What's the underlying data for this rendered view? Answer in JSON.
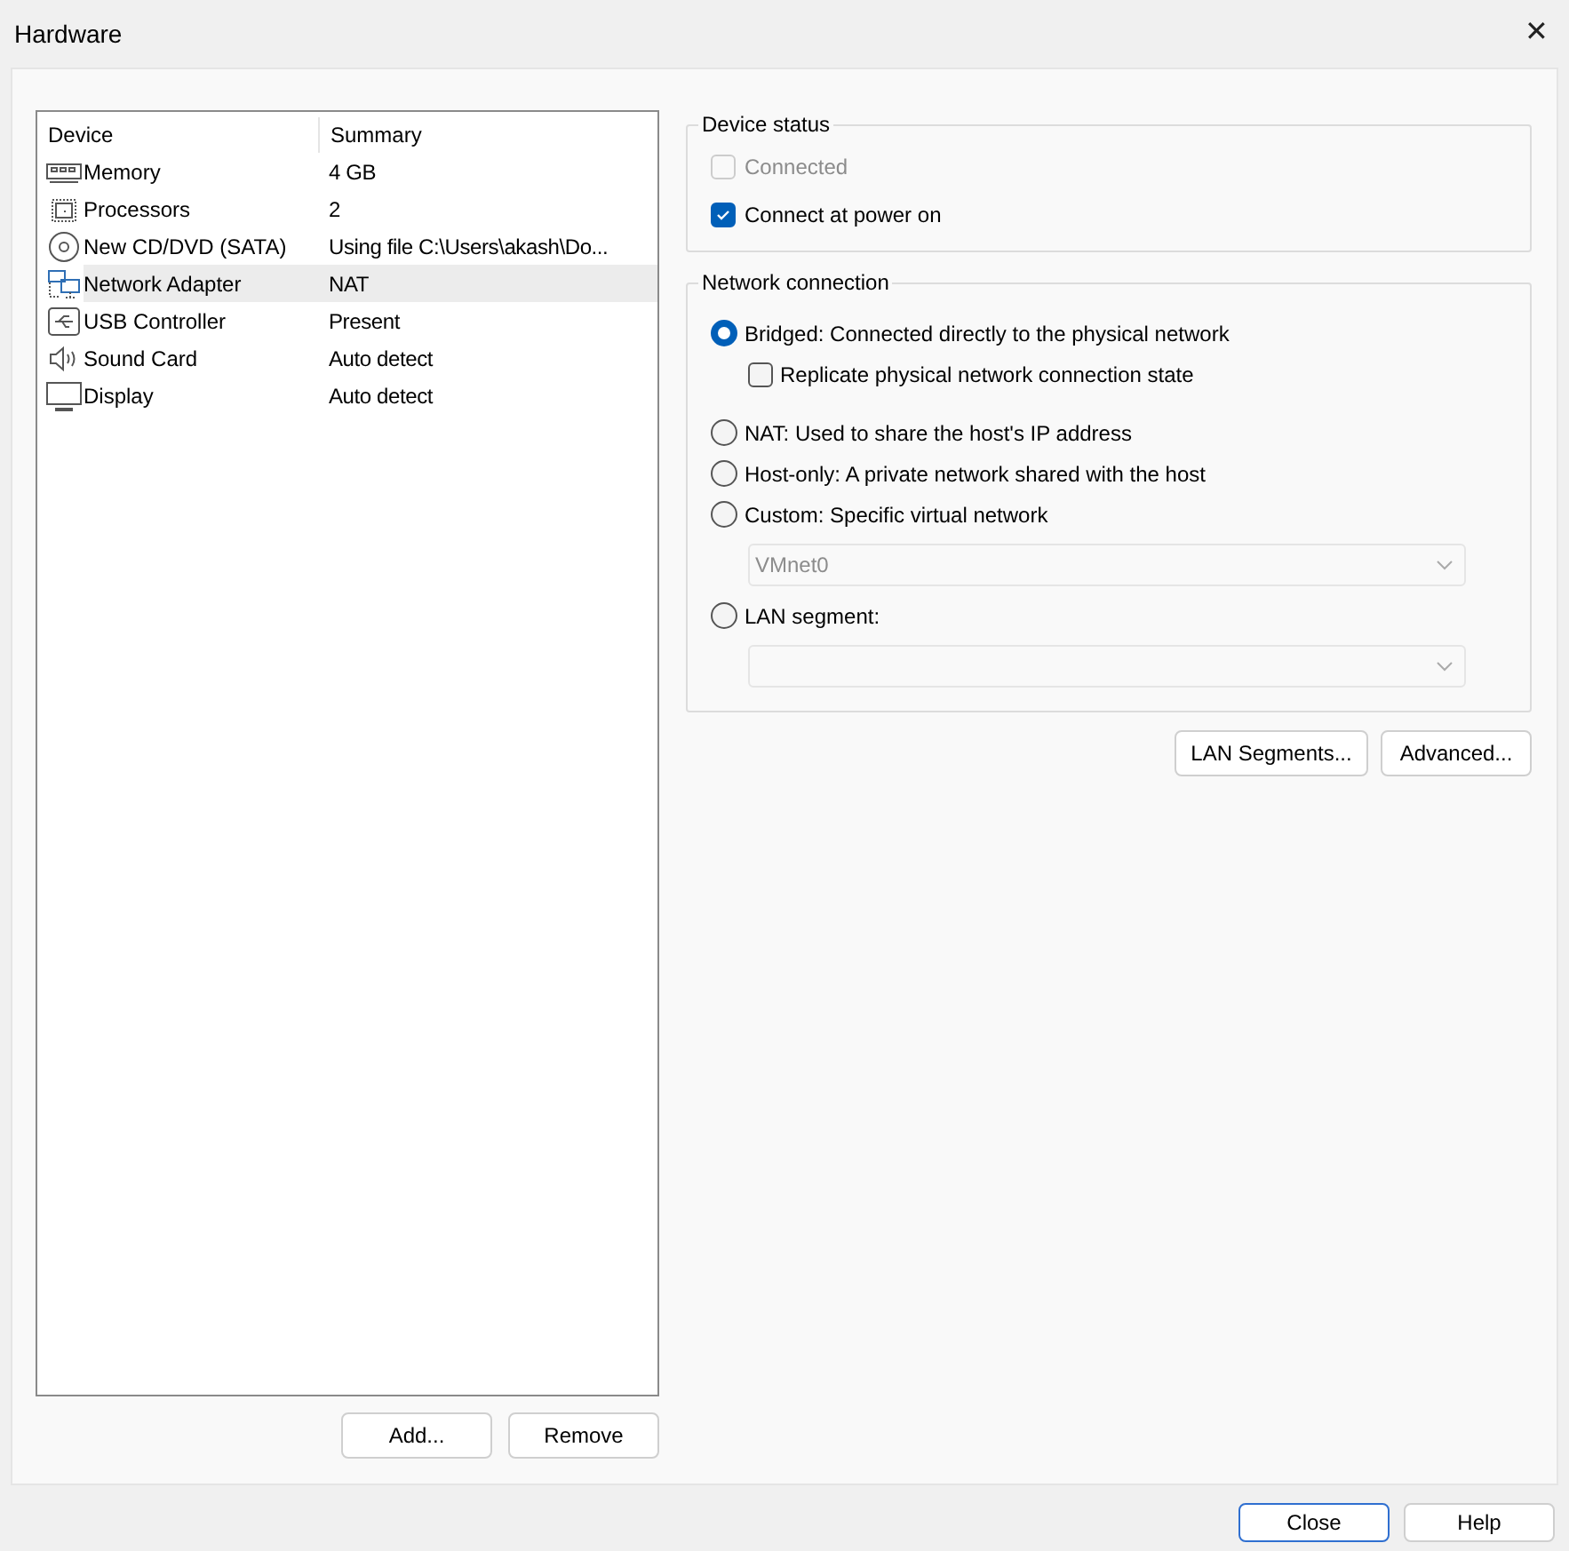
{
  "window": {
    "title": "Hardware",
    "close_glyph": "✕"
  },
  "device_table": {
    "columns": [
      "Device",
      "Summary"
    ],
    "rows": [
      {
        "kind": "memory",
        "device": "Memory",
        "summary": "4 GB",
        "selected": false
      },
      {
        "kind": "processor",
        "device": "Processors",
        "summary": "2",
        "selected": false
      },
      {
        "kind": "disc",
        "device": "New CD/DVD (SATA)",
        "summary": "Using file C:\\Users\\akash\\Do...",
        "selected": false
      },
      {
        "kind": "network",
        "device": "Network Adapter",
        "summary": "NAT",
        "selected": true
      },
      {
        "kind": "usb",
        "device": "USB Controller",
        "summary": "Present",
        "selected": false
      },
      {
        "kind": "sound",
        "device": "Sound Card",
        "summary": "Auto detect",
        "selected": false
      },
      {
        "kind": "display",
        "device": "Display",
        "summary": "Auto detect",
        "selected": false
      }
    ]
  },
  "list_buttons": [
    {
      "label": "Add...",
      "default": false
    },
    {
      "label": "Remove",
      "default": false
    }
  ],
  "device_status": {
    "title": "Device status",
    "items": [
      {
        "label": "Connected",
        "checked": false,
        "disabled": true
      },
      {
        "label": "Connect at power on",
        "checked": true,
        "disabled": false
      }
    ]
  },
  "network_connection": {
    "title": "Network connection",
    "items": [
      {
        "kind": "radio",
        "label": "Bridged: Connected directly to the physical network",
        "selected": true
      },
      {
        "kind": "checkbox",
        "label": "Replicate physical network connection state",
        "checked": false
      },
      {
        "kind": "radio",
        "label": "NAT: Used to share the host's IP address",
        "selected": false
      },
      {
        "kind": "radio",
        "label": "Host-only: A private network shared with the host",
        "selected": false
      },
      {
        "kind": "radio",
        "label": "Custom: Specific virtual network",
        "selected": false
      },
      {
        "kind": "dropdown",
        "value": "VMnet0",
        "disabled": true
      },
      {
        "kind": "radio",
        "label": "LAN segment:",
        "selected": false
      },
      {
        "kind": "dropdown",
        "disabled": true
      }
    ]
  },
  "network_buttons": [
    {
      "label": "LAN Segments...",
      "default": false
    },
    {
      "label": "Advanced...",
      "default": false
    }
  ],
  "footer_buttons": [
    {
      "label": "Close",
      "default": true
    },
    {
      "label": "Help",
      "default": false
    }
  ]
}
